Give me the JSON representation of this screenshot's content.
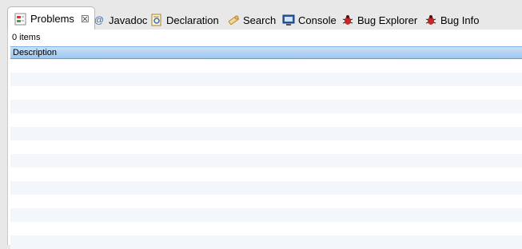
{
  "tabs": [
    {
      "label": "Problems",
      "icon": "problems-icon",
      "active": true
    },
    {
      "label": "Javadoc",
      "icon": "javadoc-icon"
    },
    {
      "label": "Declaration",
      "icon": "declaration-icon"
    },
    {
      "label": "Search",
      "icon": "search-icon"
    },
    {
      "label": "Console",
      "icon": "console-icon"
    },
    {
      "label": "Bug Explorer",
      "icon": "bug-icon"
    },
    {
      "label": "Bug Info",
      "icon": "bug-icon"
    }
  ],
  "close_glyph": "☒",
  "javadoc_glyph": "@",
  "problems": {
    "count_text": "0 items",
    "columns": [
      "Description"
    ]
  },
  "colors": {
    "header_blue": "#9cc6ef",
    "row_stripe": "#f3f6fa"
  }
}
